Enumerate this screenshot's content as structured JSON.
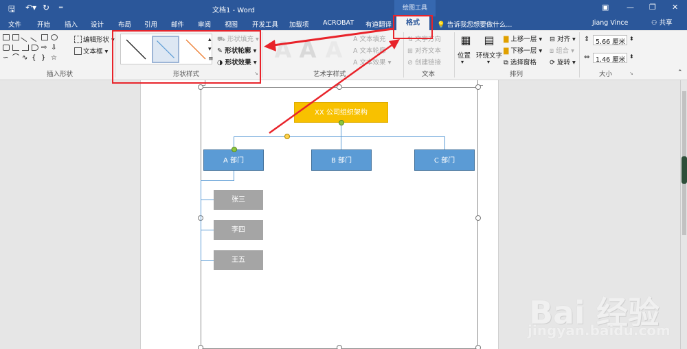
{
  "titlebar": {
    "doc_title": "文档1 - Word",
    "drawing_tools": "绘图工具"
  },
  "tabs": [
    "文件",
    "开始",
    "插入",
    "设计",
    "布局",
    "引用",
    "邮件",
    "审阅",
    "视图",
    "开发工具",
    "加载项",
    "ACROBAT",
    "有道翻译"
  ],
  "active_tab": "格式",
  "tellme_placeholder": "告诉我您想要做什么...",
  "user": "Jiang Vince",
  "share": "共享",
  "ribbon": {
    "insert_shapes": {
      "label": "插入形状",
      "edit_shape": "编辑形状",
      "text_box": "文本框"
    },
    "shape_styles": {
      "label": "形状样式",
      "fill": "形状填充",
      "outline": "形状轮廓",
      "effects": "形状效果"
    },
    "wordart": {
      "label": "艺术字样式",
      "glyph": "A",
      "text_fill": "文本填充",
      "text_outline": "文本轮廓",
      "text_effects": "文本效果"
    },
    "text": {
      "label": "文本",
      "direction": "文字方向",
      "align": "对齐文本",
      "link": "创建链接"
    },
    "arrange": {
      "label": "排列",
      "position": "位置",
      "wrap": "环绕文字",
      "bring_forward": "上移一层",
      "send_backward": "下移一层",
      "selection_pane": "选择窗格",
      "align": "对齐",
      "group": "组合",
      "rotate": "旋转"
    },
    "size": {
      "label": "大小",
      "height": "5.66 厘米",
      "width": "1.46 厘米"
    }
  },
  "org_chart": {
    "root": "XX 公司组织架构",
    "depts": [
      "A 部门",
      "B 部门",
      "C 部门"
    ],
    "staff": [
      "张三",
      "李四",
      "王五"
    ]
  },
  "colors": {
    "title_bar": "#2b579a",
    "root_node": "#f8c100",
    "dept_node": "#5b9bd5",
    "staff_node": "#a5a5a5",
    "highlight": "#e8232a"
  },
  "watermark": {
    "brand": "Bai 经验",
    "url": "jingyan.baidu.com"
  }
}
